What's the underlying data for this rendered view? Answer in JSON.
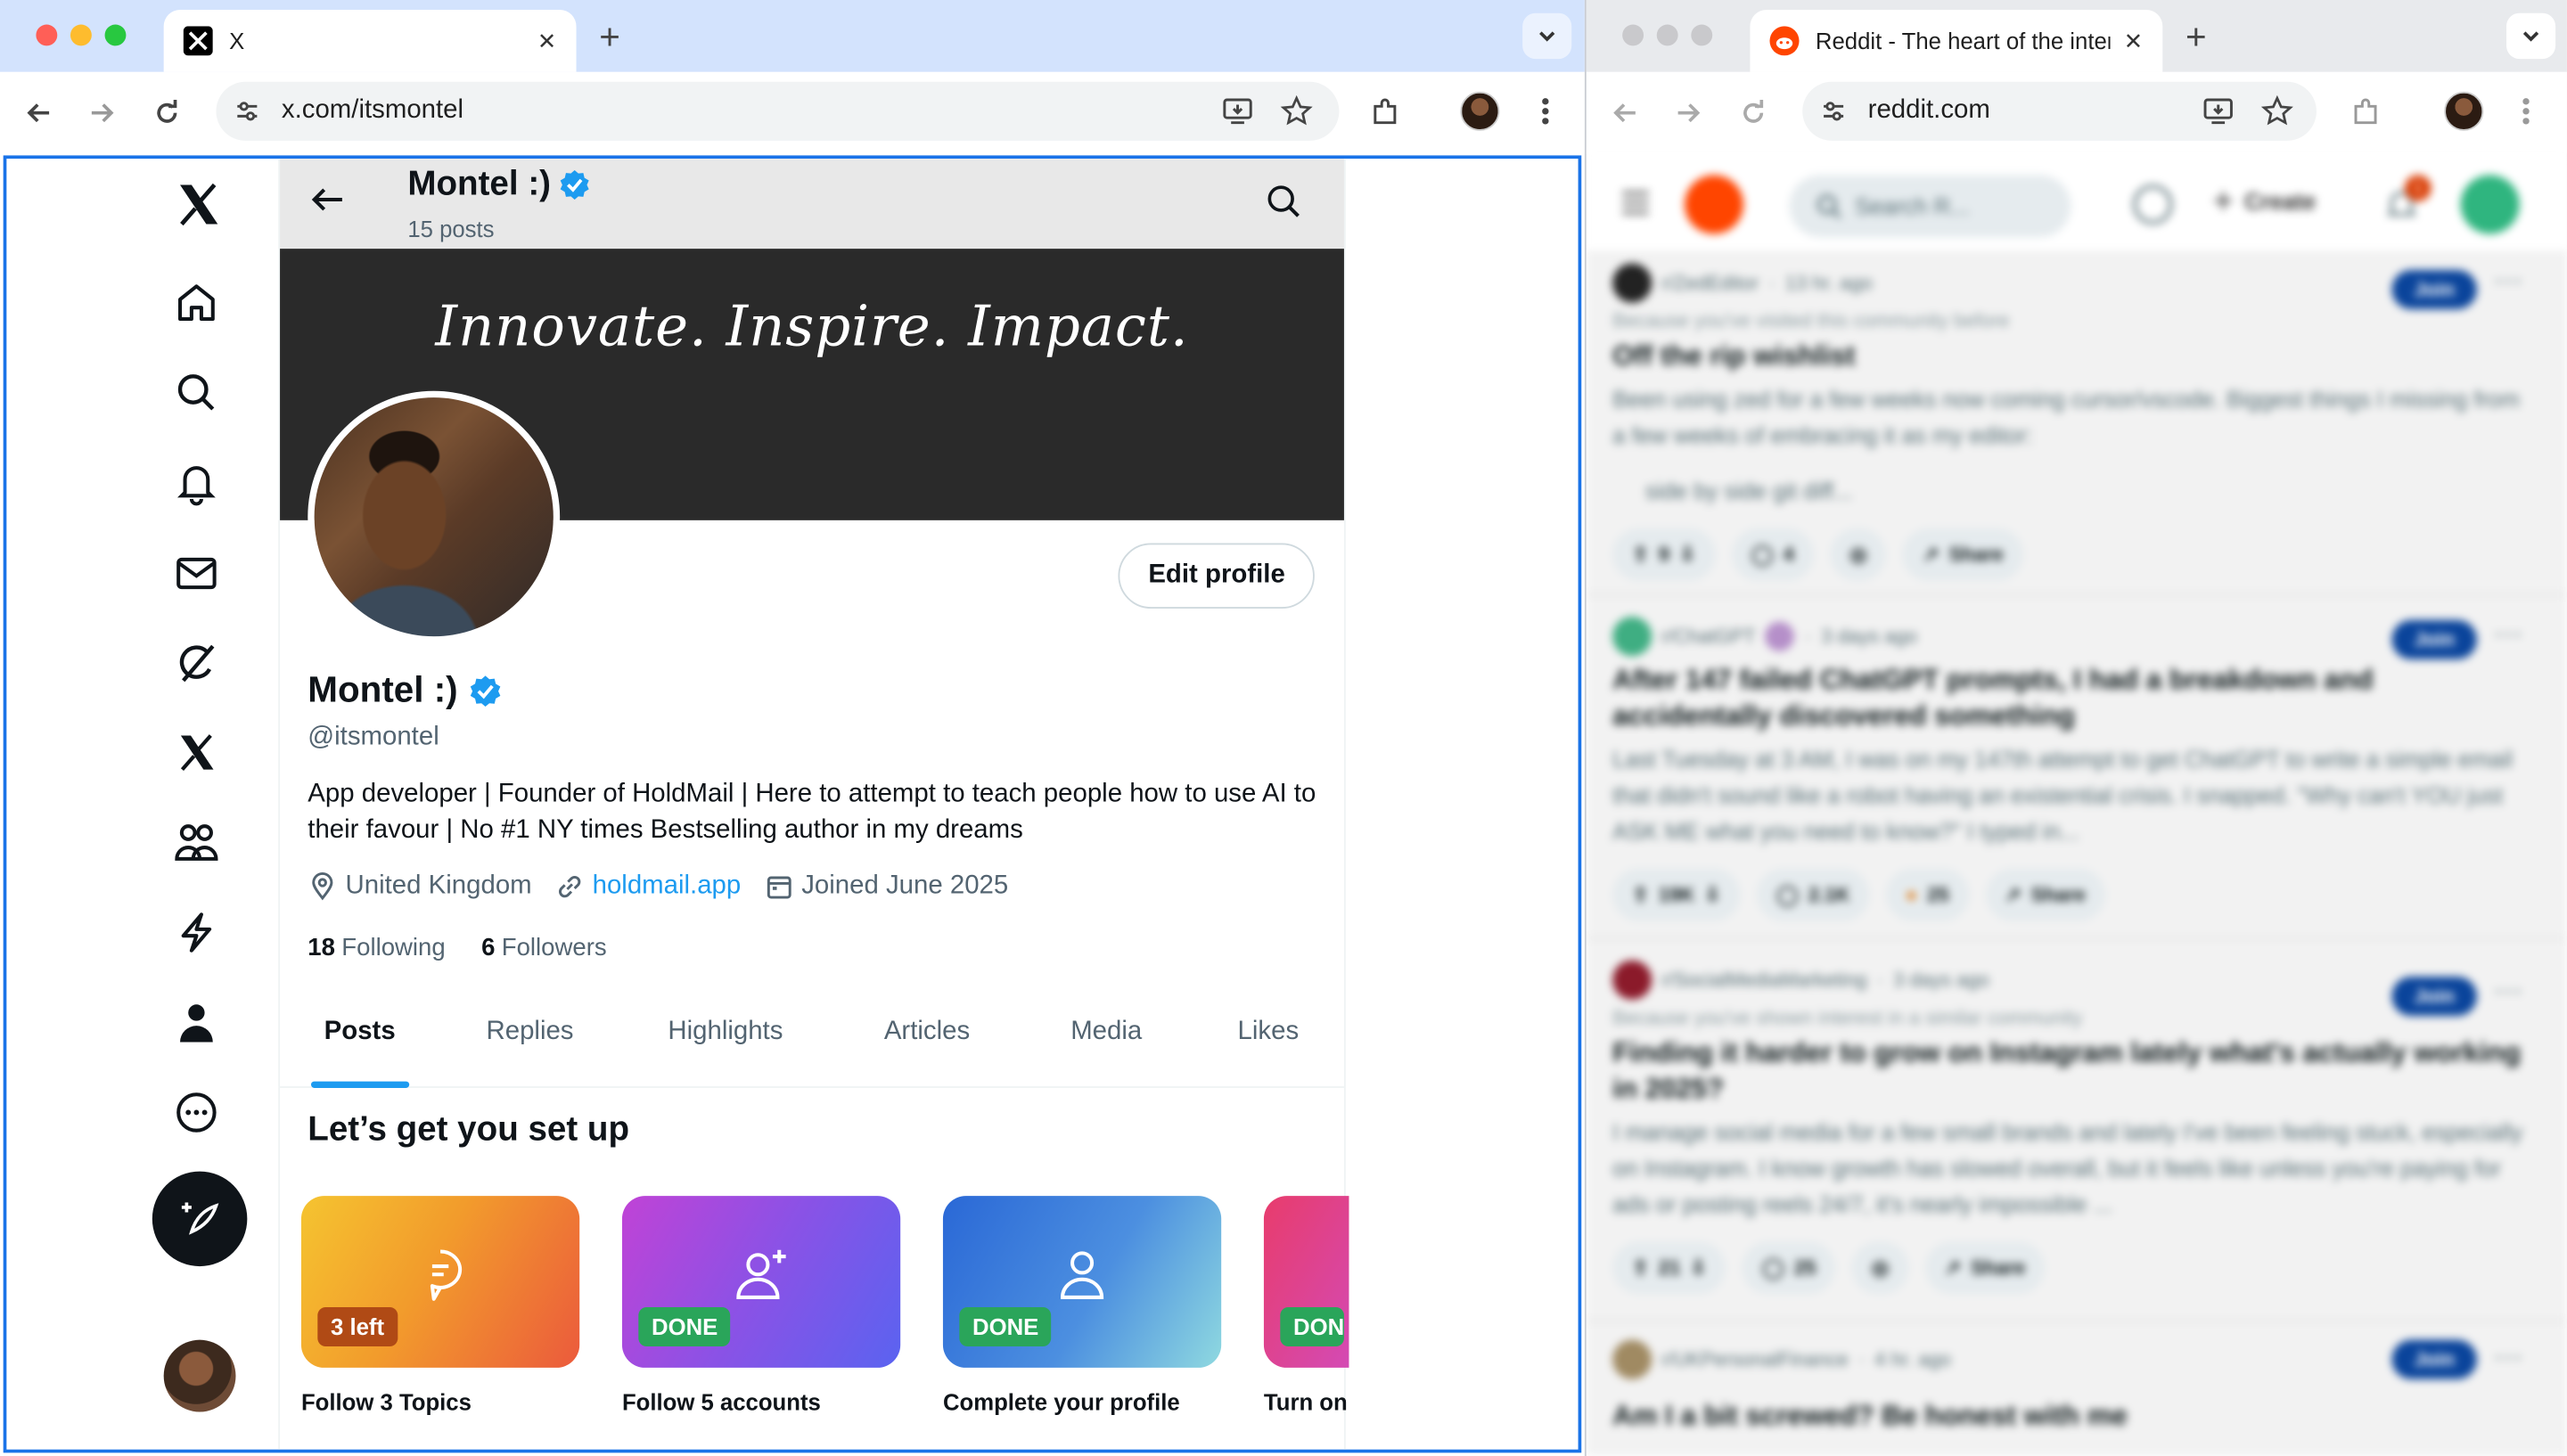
{
  "left_window": {
    "tab": {
      "title": "X"
    },
    "url": "x.com/itsmontel"
  },
  "right_window": {
    "tab": {
      "title": "Reddit - The heart of the inter"
    },
    "url": "reddit.com"
  },
  "x_profile": {
    "header": {
      "name": "Montel :)",
      "post_count": "15 posts"
    },
    "banner_text": "Innovate. Inspire. Impact.",
    "edit_profile_label": "Edit profile",
    "display_name": "Montel :)",
    "handle": "@itsmontel",
    "bio": "App developer | Founder of HoldMail | Here to attempt to teach people how to use AI to their favour | No #1 NY times Bestselling author in my dreams",
    "location": "United Kingdom",
    "website": "holdmail.app",
    "joined": "Joined June 2025",
    "following_count": "18",
    "following_label": "Following",
    "followers_count": "6",
    "followers_label": "Followers",
    "tabs": [
      {
        "label": "Posts",
        "active": true
      },
      {
        "label": "Replies"
      },
      {
        "label": "Highlights"
      },
      {
        "label": "Articles"
      },
      {
        "label": "Media"
      },
      {
        "label": "Likes"
      }
    ],
    "setup_title": "Let’s get you set up",
    "setup_cards": [
      {
        "badge": "3 left",
        "label": "Follow 3 Topics",
        "icon": "topic-bubble-icon"
      },
      {
        "badge": "DONE",
        "label": "Follow 5 accounts",
        "icon": "add-person-icon"
      },
      {
        "badge": "DONE",
        "label": "Complete your profile",
        "icon": "person-icon"
      },
      {
        "badge": "DON",
        "label": "Turn on",
        "icon": "bell-icon"
      }
    ],
    "nav_icons": [
      "x-logo-icon",
      "home-icon",
      "search-icon",
      "bell-icon",
      "mail-icon",
      "grok-icon",
      "x-premium-icon",
      "communities-icon",
      "lightning-icon",
      "profile-icon",
      "more-icon",
      "compose-icon"
    ]
  },
  "reddit": {
    "search_placeholder": "Search R...",
    "create_label": "Create",
    "notification_count": "1",
    "posts": [
      {
        "subreddit": "r/ZedEditor",
        "age": "13 hr. ago",
        "reason": "Because you've visited this community before",
        "title": "Off the rip wishlist",
        "body": "Been using zed for a few weeks now coming cursor/vscode. Biggest things I missing from a few weeks of embracing it as my editor:",
        "bullet": "side by side git diff...",
        "votes": "9",
        "comments": "4",
        "share": "Share",
        "join": "Join"
      },
      {
        "subreddit": "r/ChatGPT",
        "age": "3 days ago",
        "title": "After 147 failed ChatGPT prompts, I had a breakdown and accidentally discovered something",
        "body": "Last Tuesday at 3 AM, I was on my 147th attempt to get ChatGPT to write a simple email that didn't sound like a robot having an existential crisis. I snapped. \"Why can't YOU just ASK ME what you need to know?\" I typed in...",
        "votes": "19K",
        "comments": "2.1K",
        "awards": "25",
        "share": "Share",
        "join": "Join"
      },
      {
        "subreddit": "r/SocialMediaMarketing",
        "age": "3 days ago",
        "reason": "Because you've shown interest in a similar community",
        "title": "Finding it harder to grow on Instagram lately what's actually working in 2025?",
        "body": "I manage social media for a few small brands and lately I've been feeling stuck, especially on Instagram. I know growth has slowed overall, but it feels like unless you're paying for ads or posting reels 24/7, it's nearly impossible ...",
        "votes": "21",
        "comments": "25",
        "share": "Share",
        "join": "Join"
      },
      {
        "subreddit": "r/UKPersonalFinance",
        "age": "4 hr. ago",
        "title": "Am I a bit screwed? Be honest with me",
        "join": "Join"
      }
    ]
  },
  "colors": {
    "x_blue": "#1d9bf0",
    "reddit_orange": "#ff4500",
    "reddit_join": "#0a449b"
  }
}
